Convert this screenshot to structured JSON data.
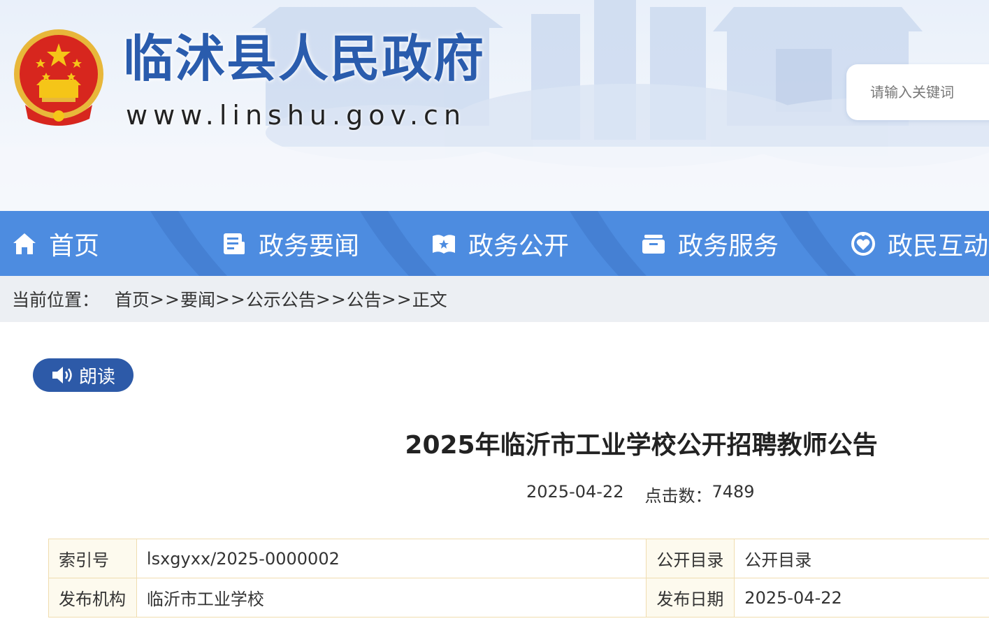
{
  "header": {
    "site_title": "临沭县人民政府",
    "site_url": "www.linshu.gov.cn",
    "search_placeholder": "请输入关键词"
  },
  "nav": {
    "items": [
      {
        "label": "首页",
        "icon": "home-icon"
      },
      {
        "label": "政务要闻",
        "icon": "news-icon"
      },
      {
        "label": "政务公开",
        "icon": "open-book-icon"
      },
      {
        "label": "政务服务",
        "icon": "service-box-icon"
      },
      {
        "label": "政民互动",
        "icon": "interaction-icon"
      }
    ],
    "color": "#4d8ce0"
  },
  "breadcrumb": {
    "label": "当前位置：",
    "items": [
      "首页",
      "要闻",
      "公示公告",
      "公告",
      "正文"
    ],
    "separator": ">>"
  },
  "toolbar": {
    "read_label": "朗读"
  },
  "article": {
    "title": "2025年临沂市工业学校公开招聘教师公告",
    "date": "2025-04-22",
    "clicks_label": "点击数：",
    "clicks": "7489"
  },
  "info_table": {
    "rows": [
      {
        "k1": "索引号",
        "v1": "lsxgyxx/2025-0000002",
        "k2": "公开目录",
        "v2": "公开目录"
      },
      {
        "k1": "发布机构",
        "v1": "临沂市工业学校",
        "k2": "发布日期",
        "v2": "2025-04-22"
      }
    ]
  },
  "colors": {
    "brand_blue": "#2a5cad",
    "nav_blue": "#4d8ce0",
    "read_button": "#2d5aa8",
    "emblem_red": "#d7261e",
    "emblem_gold": "#f5c518"
  }
}
